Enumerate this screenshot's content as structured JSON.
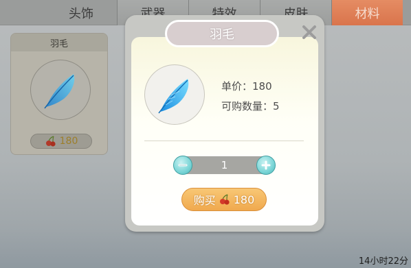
{
  "tabs": [
    {
      "label": "头饰",
      "active": false
    },
    {
      "label": "武器",
      "active": false
    },
    {
      "label": "特效",
      "active": false
    },
    {
      "label": "皮肤",
      "active": false
    },
    {
      "label": "材料",
      "active": true
    }
  ],
  "item_card": {
    "name": "羽毛",
    "price": "180",
    "icon": "feather-icon",
    "currency_icon": "cherry-icon"
  },
  "dialog": {
    "title": "羽毛",
    "unit_price": "单价：180",
    "purchasable": "可购数量：5",
    "quantity": "1",
    "buy_label": "购买",
    "buy_price": "180",
    "close_icon": "close-icon"
  },
  "timer": "14小时22分",
  "colors": {
    "active_tab": "#e0804f",
    "feather": "#3fb2f0",
    "stepper_button": "#7ad5d6",
    "buy_button": "#f3b35d",
    "price_text": "#9d7f2a"
  }
}
